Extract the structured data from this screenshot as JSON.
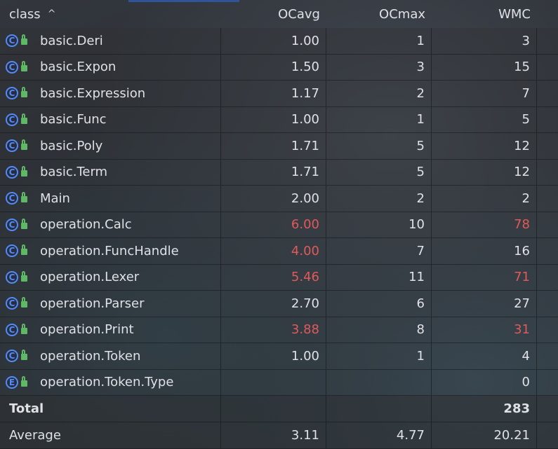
{
  "header": {
    "class_label": "class",
    "sort_glyph": "^",
    "col1": "OCavg",
    "col2": "OCmax",
    "col3": "WMC"
  },
  "colors": {
    "warning": "#e05a5a",
    "class_icon": "#548af7",
    "lock_icon": "#5fb865"
  },
  "rows": [
    {
      "icon": "C",
      "name": "basic.Deri",
      "ocavg": "1.00",
      "ocmax": "1",
      "wmc": "3",
      "ocavg_warn": false,
      "wmc_warn": false
    },
    {
      "icon": "C",
      "name": "basic.Expon",
      "ocavg": "1.50",
      "ocmax": "3",
      "wmc": "15",
      "ocavg_warn": false,
      "wmc_warn": false
    },
    {
      "icon": "C",
      "name": "basic.Expression",
      "ocavg": "1.17",
      "ocmax": "2",
      "wmc": "7",
      "ocavg_warn": false,
      "wmc_warn": false
    },
    {
      "icon": "C",
      "name": "basic.Func",
      "ocavg": "1.00",
      "ocmax": "1",
      "wmc": "5",
      "ocavg_warn": false,
      "wmc_warn": false
    },
    {
      "icon": "C",
      "name": "basic.Poly",
      "ocavg": "1.71",
      "ocmax": "5",
      "wmc": "12",
      "ocavg_warn": false,
      "wmc_warn": false
    },
    {
      "icon": "C",
      "name": "basic.Term",
      "ocavg": "1.71",
      "ocmax": "5",
      "wmc": "12",
      "ocavg_warn": false,
      "wmc_warn": false
    },
    {
      "icon": "C",
      "name": "Main",
      "ocavg": "2.00",
      "ocmax": "2",
      "wmc": "2",
      "ocavg_warn": false,
      "wmc_warn": false
    },
    {
      "icon": "C",
      "name": "operation.Calc",
      "ocavg": "6.00",
      "ocmax": "10",
      "wmc": "78",
      "ocavg_warn": true,
      "wmc_warn": true
    },
    {
      "icon": "C",
      "name": "operation.FuncHandle",
      "ocavg": "4.00",
      "ocmax": "7",
      "wmc": "16",
      "ocavg_warn": true,
      "wmc_warn": false
    },
    {
      "icon": "C",
      "name": "operation.Lexer",
      "ocavg": "5.46",
      "ocmax": "11",
      "wmc": "71",
      "ocavg_warn": true,
      "wmc_warn": true
    },
    {
      "icon": "C",
      "name": "operation.Parser",
      "ocavg": "2.70",
      "ocmax": "6",
      "wmc": "27",
      "ocavg_warn": false,
      "wmc_warn": false
    },
    {
      "icon": "C",
      "name": "operation.Print",
      "ocavg": "3.88",
      "ocmax": "8",
      "wmc": "31",
      "ocavg_warn": true,
      "wmc_warn": true
    },
    {
      "icon": "C",
      "name": "operation.Token",
      "ocavg": "1.00",
      "ocmax": "1",
      "wmc": "4",
      "ocavg_warn": false,
      "wmc_warn": false
    },
    {
      "icon": "E",
      "name": "operation.Token.Type",
      "ocavg": "",
      "ocmax": "",
      "wmc": "0",
      "ocavg_warn": false,
      "wmc_warn": false
    }
  ],
  "total": {
    "label": "Total",
    "ocavg": "",
    "ocmax": "",
    "wmc": "283"
  },
  "average": {
    "label": "Average",
    "ocavg": "3.11",
    "ocmax": "4.77",
    "wmc": "20.21"
  }
}
